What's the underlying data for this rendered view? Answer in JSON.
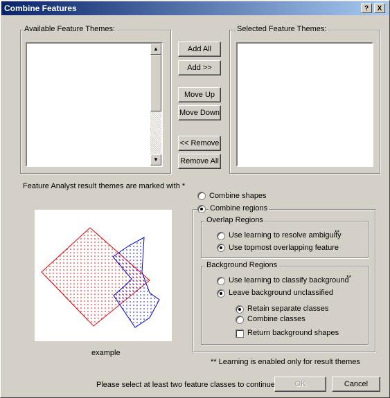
{
  "window": {
    "title": "Combine Features",
    "help_btn": "?",
    "close_btn": "X"
  },
  "available": {
    "label": "Available Feature Themes:"
  },
  "selected": {
    "label": "Selected Feature Themes:"
  },
  "buttons": {
    "add_all": "Add All",
    "add": "Add >>",
    "move_up": "Move Up",
    "move_down": "Move Down",
    "remove": "<< Remove",
    "remove_all": "Remove All",
    "ok": "OK",
    "cancel": "Cancel"
  },
  "notes": {
    "marked": "Feature Analyst result themes are marked with *",
    "example": "example",
    "learning": "** Learning is enabled only for result themes",
    "status": "Please select at least two feature classes to continue"
  },
  "options": {
    "combine_shapes": "Combine shapes",
    "combine_regions": "Combine regions",
    "overlap_label": "Overlap Regions",
    "overlap_learning": "Use learning to resolve ambiguity",
    "overlap_learning_mark": "**",
    "overlap_topmost": "Use topmost overlapping feature",
    "background_label": "Background Regions",
    "bg_learning": "Use learning to classify background",
    "bg_learning_mark": "**",
    "bg_leave": "Leave background unclassified",
    "retain": "Retain separate classes",
    "combine_classes": "Combine classes",
    "return_shapes": "Return background shapes"
  },
  "state": {
    "combine_mode": "combine_regions",
    "overlap": "topmost",
    "background": "leave",
    "classes": "retain",
    "return_background_shapes": false
  },
  "colors": {
    "red_shape": "#e00000",
    "blue_shape": "#0000d0",
    "title_start": "#0a246a",
    "title_end": "#a6caf0"
  }
}
